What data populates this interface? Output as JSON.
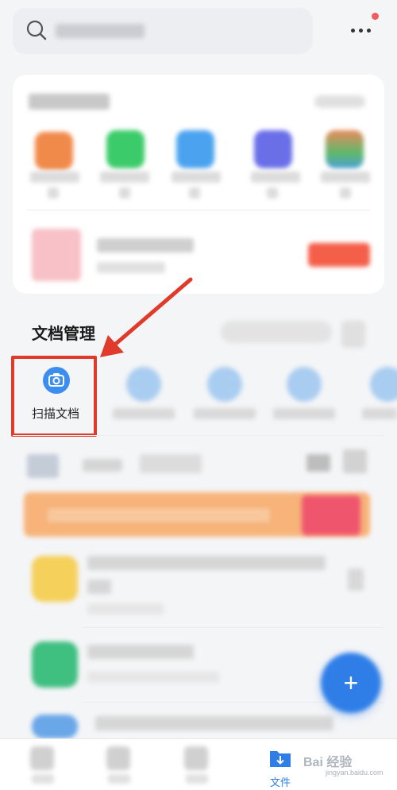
{
  "search": {
    "placeholder": ""
  },
  "header": {
    "more_icon": "more-dots-icon",
    "notification_dot_color": "#f25c5c"
  },
  "apps_card": {
    "apps": [
      {
        "name": "app-orange",
        "color": "#f08a4b"
      },
      {
        "name": "app-green",
        "color": "#3ccb6a"
      },
      {
        "name": "app-blue",
        "color": "#4ba3f0"
      },
      {
        "name": "app-purple",
        "color": "#6a6fe8"
      },
      {
        "name": "app-colorful",
        "color": "#5fb86a"
      }
    ]
  },
  "doc_management": {
    "title": "文档管理",
    "scan": {
      "label": "扫描文档",
      "icon": "camera-icon"
    },
    "highlight_color": "#e03a2b",
    "accent": "#3b8ef0"
  },
  "tabbar": {
    "files_label": "文件",
    "files_icon": "folder-download-icon"
  },
  "watermark": {
    "text": "Bai 经验",
    "sub": "jingyan.baidu.com"
  }
}
